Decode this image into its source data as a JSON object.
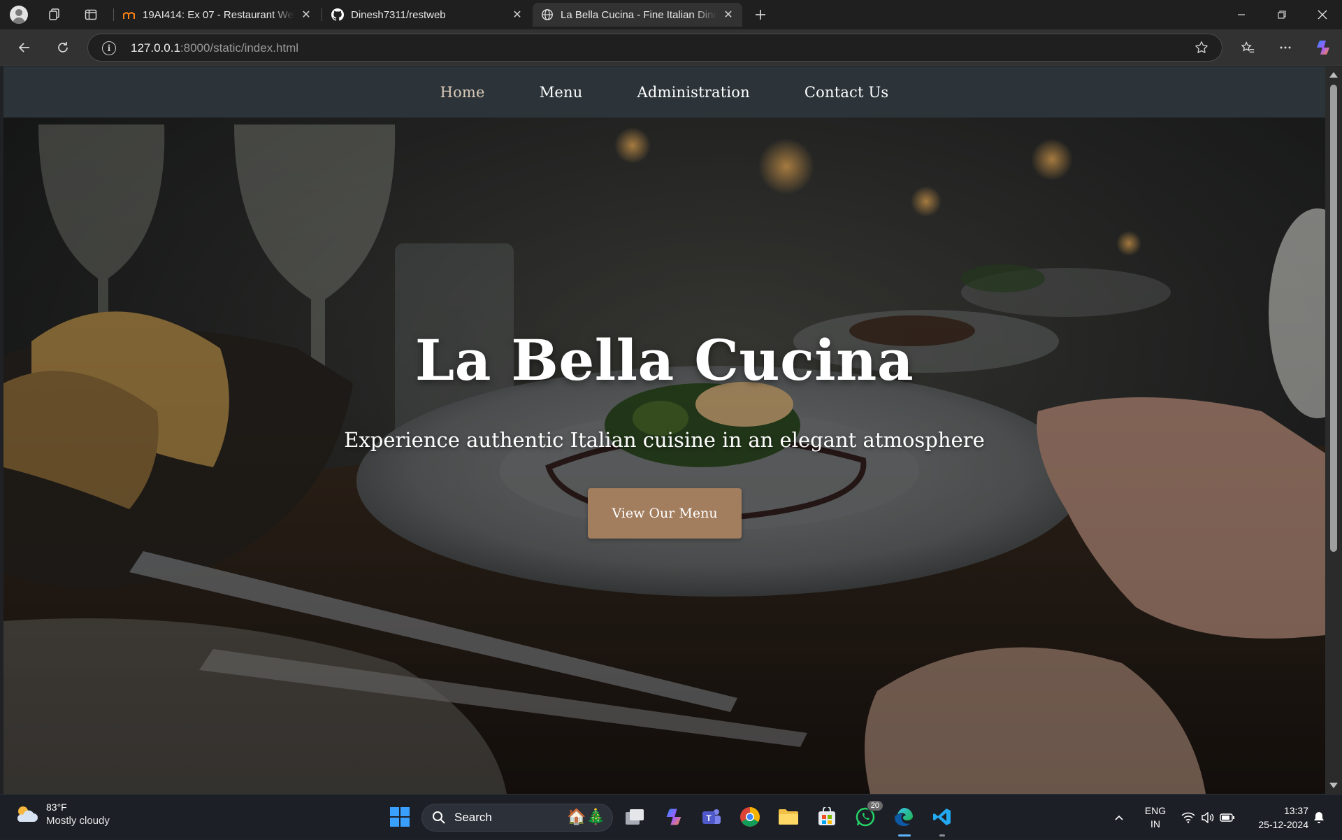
{
  "browser": {
    "tabs": [
      {
        "title": "19AI414: Ex 07 - Restaurant Webs",
        "active": false,
        "favicon": "moodle-icon"
      },
      {
        "title": "Dinesh7311/restweb",
        "active": false,
        "favicon": "github-icon"
      },
      {
        "title": "La Bella Cucina - Fine Italian Dinin",
        "active": true,
        "favicon": "globe-icon"
      }
    ],
    "address": {
      "host": "127.0.0.1",
      "rest": ":8000/static/index.html"
    }
  },
  "site": {
    "nav": {
      "home": "Home",
      "menu": "Menu",
      "administration": "Administration",
      "contact": "Contact Us"
    },
    "hero": {
      "title": "La Bella Cucina",
      "subtitle": "Experience authentic Italian cuisine in an elegant atmosphere",
      "cta": "View Our Menu"
    },
    "colors": {
      "nav_bg": "#2c3439",
      "cta_bg": "#a27d5e"
    }
  },
  "taskbar": {
    "weather": {
      "temp": "83°F",
      "condition": "Mostly cloudy"
    },
    "search_label": "Search",
    "whatsapp_badge": "20",
    "language": {
      "line1": "ENG",
      "line2": "IN"
    },
    "clock": {
      "time": "13:37",
      "date": "25-12-2024"
    }
  }
}
